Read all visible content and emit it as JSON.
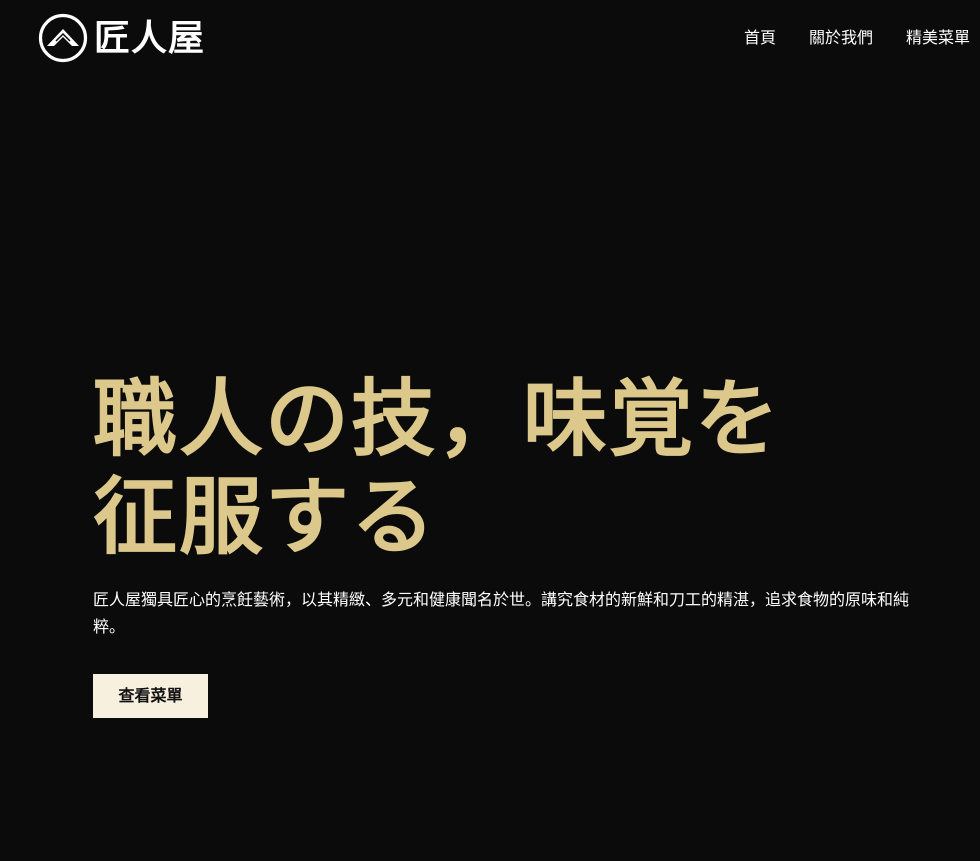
{
  "brand": {
    "name": "匠人屋",
    "logo_icon": "mountain-circle-icon"
  },
  "nav": {
    "items": [
      {
        "label": "首頁"
      },
      {
        "label": "關於我們"
      },
      {
        "label": "精美菜單"
      }
    ]
  },
  "hero": {
    "title_line1": "職人の技，味覚を",
    "title_line2": "征服する",
    "description": "匠人屋獨具匠心的烹飪藝術，以其精緻、多元和健康聞名於世。講究食材的新鮮和刀工的精湛，追求食物的原味和純粹。",
    "cta_label": "查看菜單"
  },
  "colors": {
    "background": "#0b0b0b",
    "accent_gold": "#dcc88a",
    "button_bg": "#f7f0df",
    "text": "#ffffff"
  }
}
